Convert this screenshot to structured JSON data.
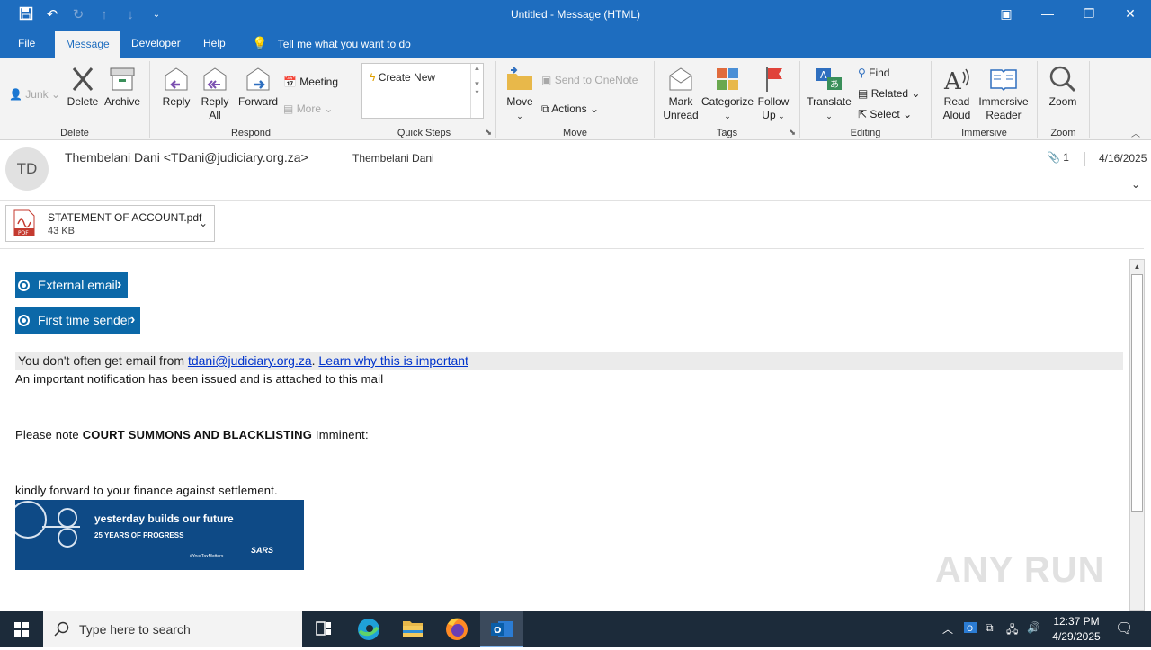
{
  "window": {
    "title": "Untitled  -  Message (HTML)"
  },
  "tabs": [
    "File",
    "Message",
    "Developer",
    "Help"
  ],
  "tellme": "Tell me what you want to do",
  "ribbon": {
    "delete_group": {
      "junk": "Junk",
      "delete": "Delete",
      "archive": "Archive",
      "label": "Delete"
    },
    "respond_group": {
      "reply": "Reply",
      "reply_all_1": "Reply",
      "reply_all_2": "All",
      "forward": "Forward",
      "meeting": "Meeting",
      "more": "More",
      "label": "Respond"
    },
    "quicksteps_group": {
      "create_new": "Create New",
      "label": "Quick Steps"
    },
    "move_group": {
      "move": "Move",
      "send_onenote": "Send to OneNote",
      "actions": "Actions",
      "label": "Move"
    },
    "tags_group": {
      "mark_unread_1": "Mark",
      "mark_unread_2": "Unread",
      "categorize": "Categorize",
      "follow_up_1": "Follow",
      "follow_up_2": "Up",
      "label": "Tags"
    },
    "editing_group": {
      "translate": "Translate",
      "find": "Find",
      "related": "Related",
      "select": "Select",
      "label": "Editing"
    },
    "immersive_group": {
      "read_aloud_1": "Read",
      "read_aloud_2": "Aloud",
      "immersive_reader_1": "Immersive",
      "immersive_reader_2": "Reader",
      "label": "Immersive"
    },
    "zoom_group": {
      "zoom": "Zoom",
      "label": "Zoom"
    }
  },
  "message": {
    "avatar_initials": "TD",
    "sender": "Thembelani Dani <TDani@judiciary.org.za>",
    "to": "Thembelani Dani",
    "attachment_count": "1",
    "date": "4/16/2025",
    "attachment": {
      "name": "STATEMENT OF ACCOUNT.pdf",
      "size": "43 KB"
    }
  },
  "body": {
    "tag_external": "External email",
    "tag_first_time": "First time sender",
    "banner_prefix": "You don't often get email from ",
    "banner_email": "tdani@judiciary.org.za",
    "banner_dot": ".",
    "banner_link": "Learn why this is important",
    "line1": "An important notification has been issued and is attached to this mail",
    "line2_prefix": "Please note ",
    "line2_bold": "COURT SUMMONS AND BLACKLISTING",
    "line2_suffix": " Imminent:",
    "line3": "kindly forward to your finance against settlement.",
    "image": {
      "headline": "yesterday builds our future",
      "subline": "25 YEARS OF PROGRESS",
      "hashtag": "#YourTaxMatters",
      "logo": "SARS"
    }
  },
  "watermark": "ANY RUN",
  "taskbar": {
    "search_placeholder": "Type here to search",
    "time": "12:37 PM",
    "date": "4/29/2025"
  },
  "colors": {
    "accent": "#1e6dbf",
    "tag_bg": "#0b68a8",
    "taskbar": "#1c2b3a"
  }
}
